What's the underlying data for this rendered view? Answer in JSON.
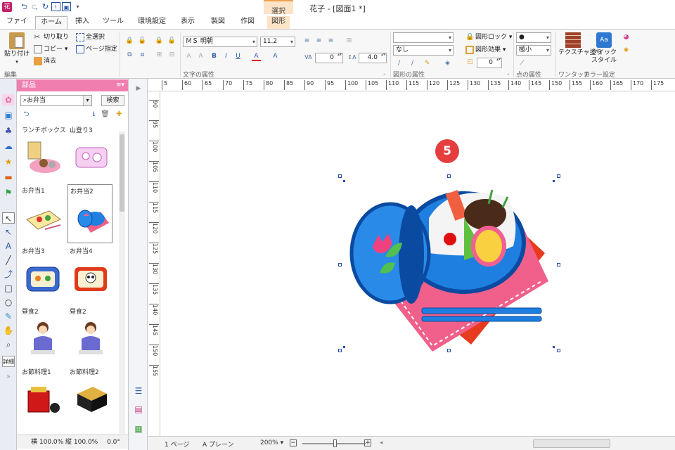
{
  "window": {
    "title": "花子 - [図面1 *]"
  },
  "ribbon_tabs": [
    "ファイル",
    "ホーム",
    "挿入",
    "ツール",
    "環境設定",
    "表示",
    "製図",
    "作図",
    "図形"
  ],
  "active_tab": "ホーム",
  "context_group": "選択",
  "edit_group": {
    "paste": "貼り付け",
    "cut": "切り取り",
    "copy": "コピー",
    "delete": "消去",
    "select_all": "全選択",
    "page_select": "ページ指定",
    "label": "編集"
  },
  "font_group": {
    "font_name": "ＭＳ 明朝",
    "font_size": "11.2",
    "label": "文字の属性",
    "spacing": "0",
    "line_height": "4.0"
  },
  "shape_group": {
    "line_style": "",
    "fill_style": "なし",
    "shape_lock": "図形ロック",
    "shape_effect": "図形効果",
    "corner_value": "0",
    "label": "図形の属性"
  },
  "point_group": {
    "point_shape": "●",
    "point_size": "極小",
    "label": "点の属性"
  },
  "texture_group": {
    "texture_fill": "テクスチャ塗り",
    "quick_style": "クイックスタイル",
    "onetouch_label": "ワンタッチ",
    "color_label": "カラー設定"
  },
  "parts_panel": {
    "title": "部品",
    "search_value": "お弁当",
    "search_button": "検索",
    "items": [
      {
        "label": "ランチボックス"
      },
      {
        "label": "山登り3"
      },
      {
        "label": "お弁当1"
      },
      {
        "label": "お弁当2"
      },
      {
        "label": "お弁当3"
      },
      {
        "label": "お弁当4"
      },
      {
        "label": "昼食2"
      },
      {
        "label": "昼食2"
      },
      {
        "label": "お節料理1"
      },
      {
        "label": "お節料理2"
      }
    ],
    "selected_index": 3,
    "scale_status": "横 100.0% 縦 100.0%",
    "angle_status": "0.0°",
    "detail_button": "詳細"
  },
  "ruler": {
    "h_ticks": [
      "5",
      "60",
      "65",
      "70",
      "75",
      "80",
      "85",
      "90",
      "95",
      "100",
      "105",
      "110",
      "115",
      "120",
      "125",
      "130",
      "135",
      "140",
      "145",
      "150",
      "155",
      "160",
      "165",
      "170",
      "175"
    ],
    "v_ticks": [
      "90",
      "95",
      "100",
      "105",
      "110",
      "115",
      "120",
      "125",
      "130",
      "135",
      "140",
      "145",
      "150",
      "155"
    ]
  },
  "canvas": {
    "step_badge": "5"
  },
  "status": {
    "page": "1 ページ",
    "layer": "A プレーン",
    "zoom": "200%"
  },
  "colors": {
    "accent_pink": "#f07fb0",
    "badge_red": "#e53e3e",
    "lunchbox_blue": "#1e7fe0",
    "cloth_pink": "#f0608a",
    "cloth_red": "#e83a1e"
  }
}
